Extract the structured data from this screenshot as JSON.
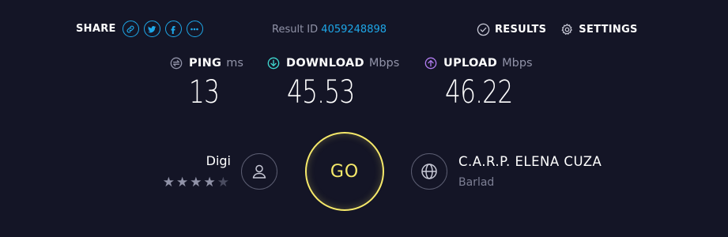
{
  "share": {
    "label": "SHARE",
    "buttons": [
      "link-icon",
      "twitter-icon",
      "facebook-icon",
      "more-icon"
    ]
  },
  "result": {
    "label": "Result ID",
    "id": "4059248898"
  },
  "nav": {
    "results": "RESULTS",
    "settings": "SETTINGS"
  },
  "metrics": {
    "ping": {
      "name": "PING",
      "unit": "ms",
      "value": "13"
    },
    "download": {
      "name": "DOWNLOAD",
      "unit": "Mbps",
      "value": "45.53"
    },
    "upload": {
      "name": "UPLOAD",
      "unit": "Mbps",
      "value": "46.22"
    }
  },
  "isp": {
    "name": "Digi",
    "rating_stars": 4,
    "rating_max": 5
  },
  "go": {
    "label": "GO"
  },
  "server": {
    "name": "C.A.R.P. ELENA CUZA",
    "location": "Barlad"
  },
  "colors": {
    "background": "#141526",
    "accent": "#1ea7e8",
    "download": "#3fd8d0",
    "upload": "#b07cf0",
    "go": "#f6e96a",
    "muted": "#9193a8"
  }
}
